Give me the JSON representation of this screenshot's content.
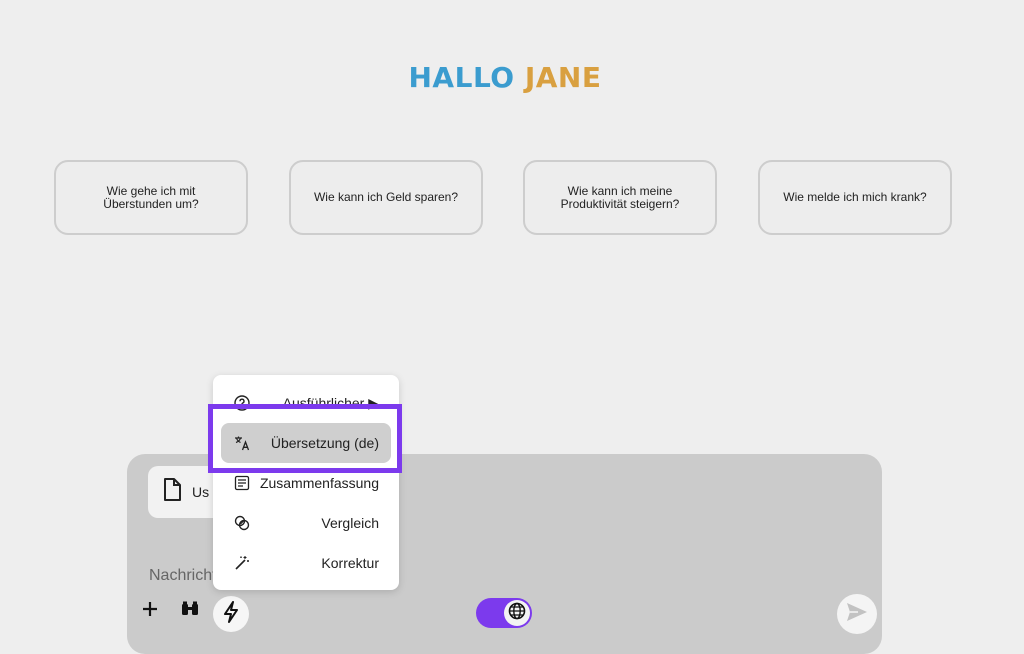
{
  "greeting": {
    "word1": "HALLO",
    "word2": "JANE",
    "color1": "#3b9ccf",
    "color2": "#e0a13a"
  },
  "suggestions": [
    {
      "line1": "Wie gehe ich mit",
      "line2": "Überstunden um?"
    },
    {
      "line1": "Wie kann ich Geld sparen?",
      "line2": ""
    },
    {
      "line1": "Wie kann ich meine",
      "line2": "Produktivität steigern?"
    },
    {
      "line1": "Wie melde ich mich krank?",
      "line2": ""
    }
  ],
  "composer": {
    "attachment_name": "Us",
    "placeholder": "Nachricht",
    "icons": [
      "plus-icon",
      "binoculars-icon",
      "lightning-icon",
      "globe-icon",
      "send-icon"
    ],
    "toggle_color": "#7c3aed"
  },
  "menu": {
    "items": [
      {
        "label": "Ausführlicher ▶",
        "icon": "question-circle-icon"
      },
      {
        "label": "Übersetzung (de)",
        "icon": "translate-icon",
        "active": true
      },
      {
        "label": "Zusammenfassung",
        "icon": "summary-icon"
      },
      {
        "label": "Vergleich",
        "icon": "compare-icon"
      },
      {
        "label": "Korrektur",
        "icon": "magic-wand-icon"
      }
    ],
    "highlight_color": "#7c3aed"
  }
}
